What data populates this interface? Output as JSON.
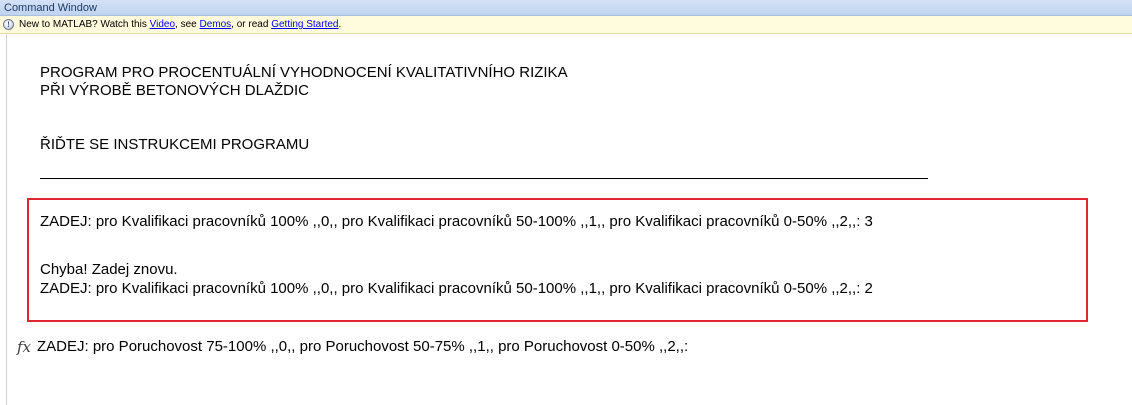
{
  "window": {
    "title": "Command Window"
  },
  "infobar": {
    "icon": "info-icon",
    "prefix": "New to MATLAB? Watch this ",
    "video_link": "Video",
    "sep1": ", see ",
    "demos_link": "Demos",
    "sep2": ", or read ",
    "getting_started_link": "Getting Started",
    "suffix": "."
  },
  "console": {
    "header_line1": "PROGRAM PRO PROCENTUÁLNÍ VYHODNOCENÍ KVALITATIVNÍHO RIZIKA",
    "header_line2": "PŘI VÝROBĚ BETONOVÝCH DLAŽDIC",
    "instruction": "ŘIĎTE SE INSTRUKCEMI PROGRAMU",
    "prompt1": "ZADEJ: pro Kvalifikaci pracovníků 100% ,,0,, pro Kvalifikaci pracovníků 50-100% ,,1,, pro Kvalifikaci pracovníků 0-50% ,,2,,: 3",
    "error": "Chyba! Zadej znovu.",
    "prompt2": "ZADEJ: pro Kvalifikaci pracovníků 100% ,,0,, pro Kvalifikaci pracovníků 50-100% ,,1,, pro Kvalifikaci pracovníků 0-50% ,,2,,: 2",
    "fx_symbol": "fx",
    "current_prompt": "ZADEJ: pro Poruchovost 75-100% ,,0,, pro Poruchovost 50-75% ,,1,, pro Poruchovost 0-50% ,,2,,:"
  },
  "colors": {
    "highlight_border": "#e0262e",
    "link": "#0000ee",
    "titlebar": "#c9dbf3",
    "infobar": "#fffbdc"
  }
}
